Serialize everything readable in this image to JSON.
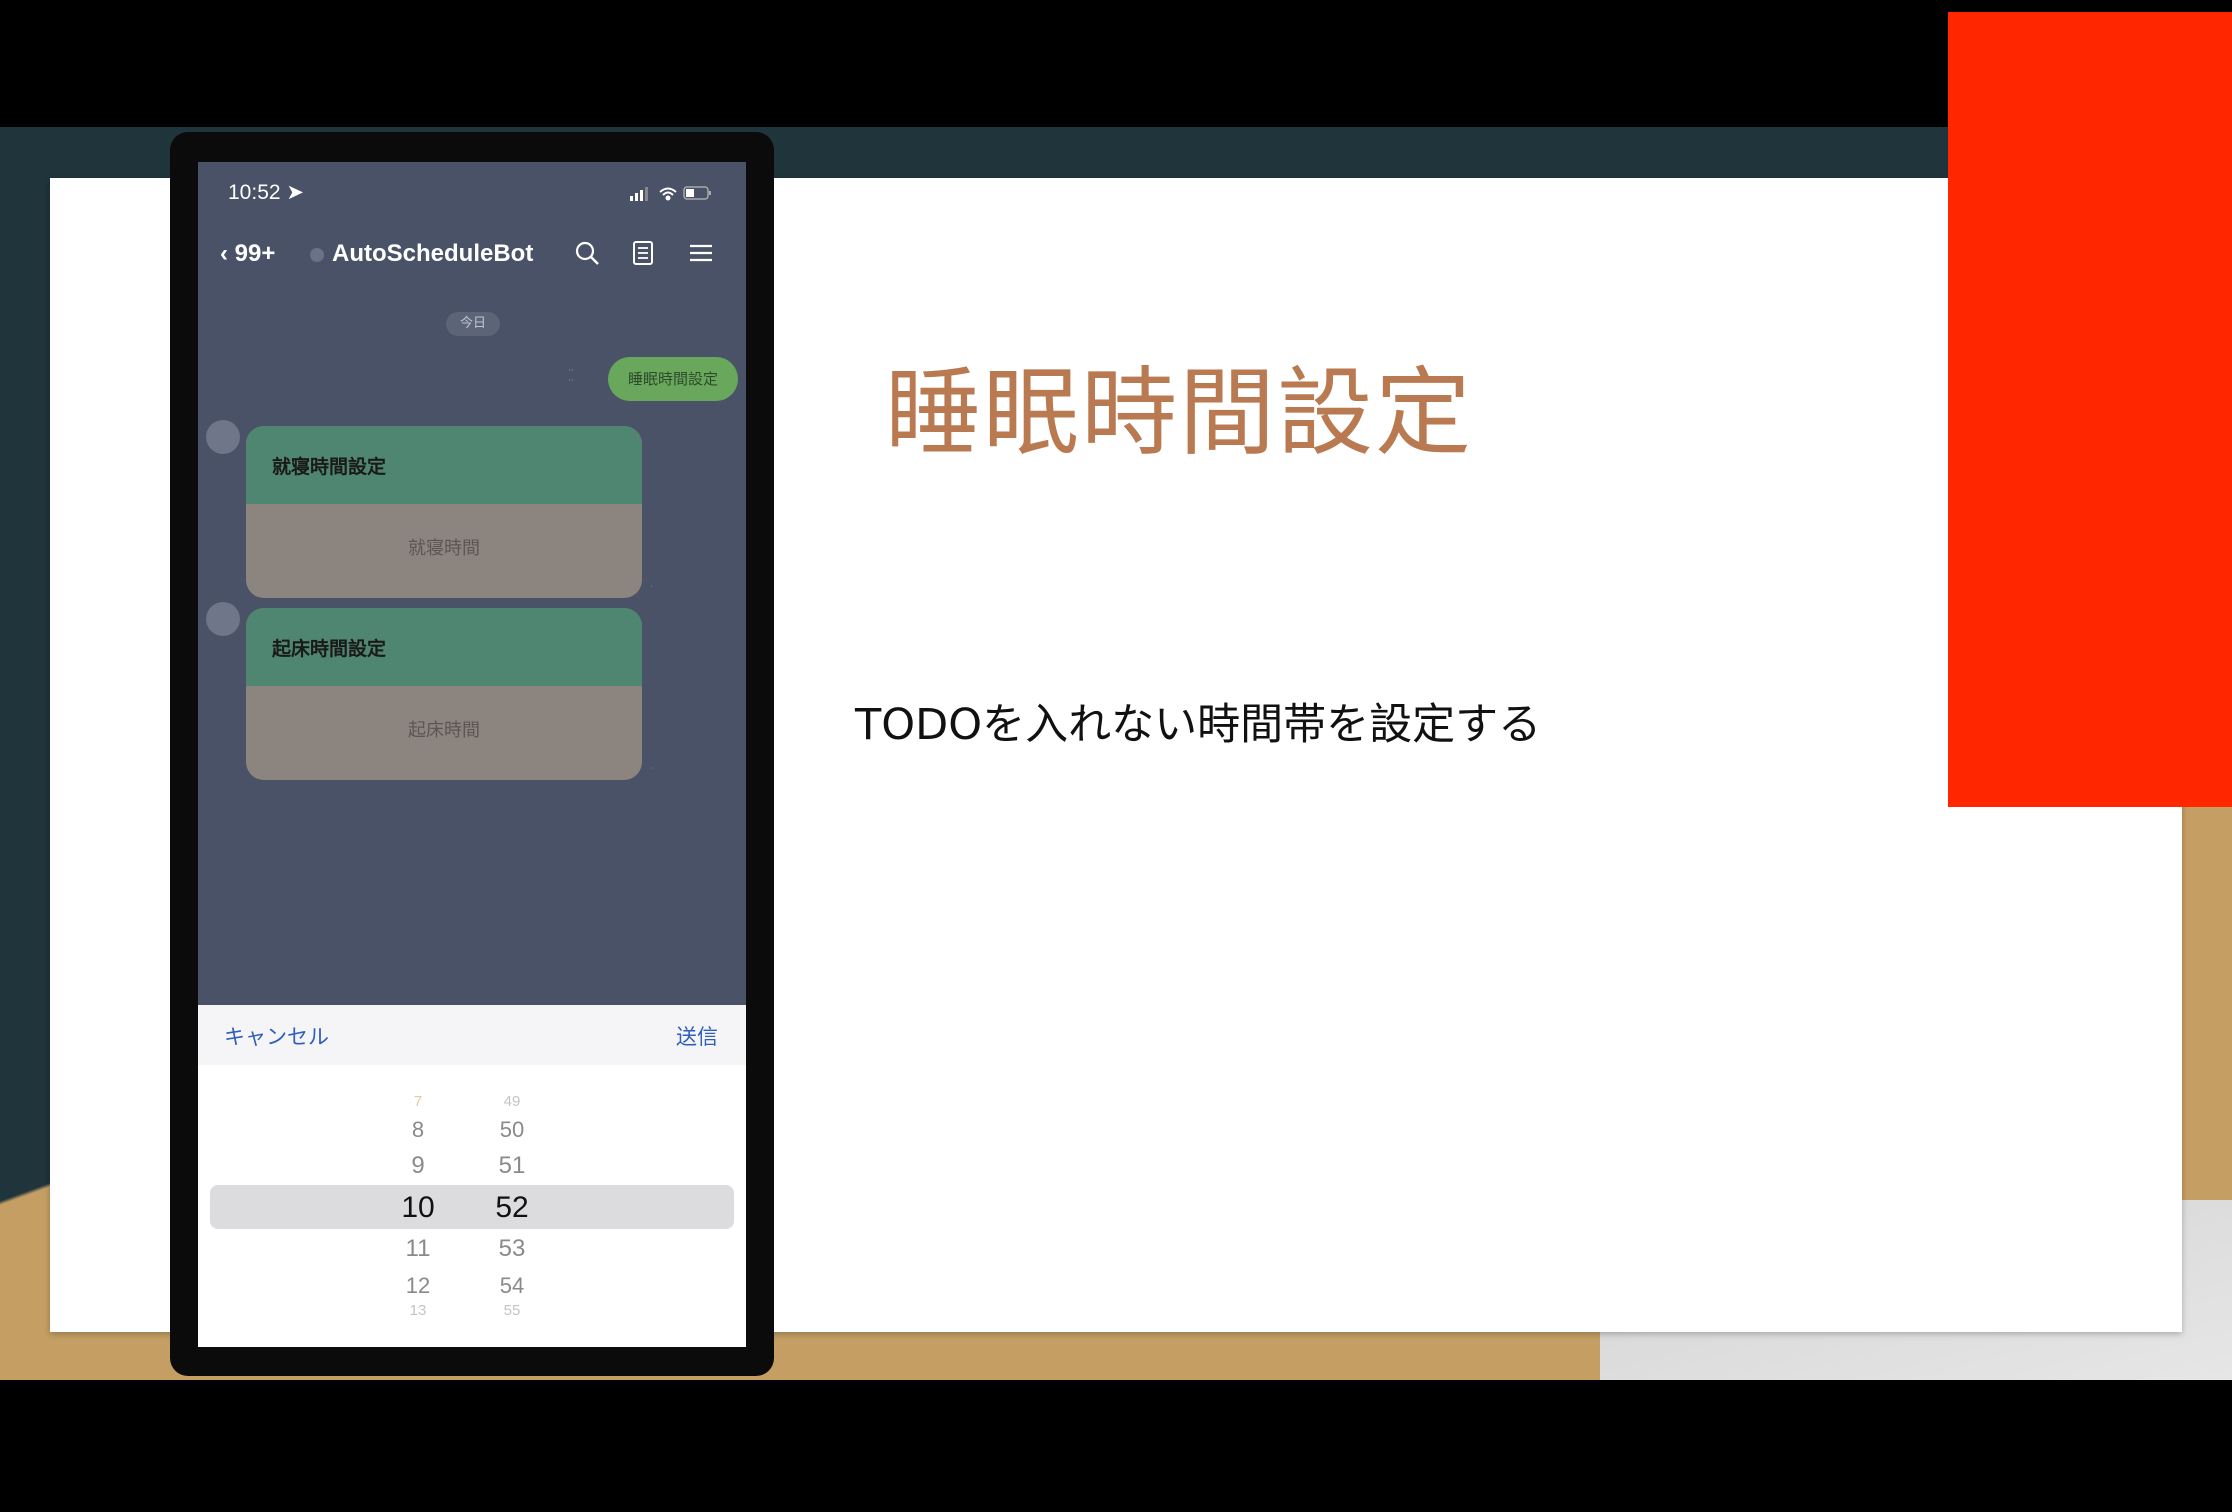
{
  "slide": {
    "title": "睡眠時間設定",
    "body": "TODOを入れない時間帯を設定する"
  },
  "colors": {
    "title": "#b97a52",
    "red_box": "#ff2600",
    "card_header": "#4f8671",
    "sent_bubble": "#69a85c",
    "link_blue": "#2f5fb8"
  },
  "phone": {
    "status": {
      "time": "10:52 ➤",
      "icons": [
        "signal-icon",
        "wifi-icon",
        "battery-icon"
      ]
    },
    "nav": {
      "back": "99+",
      "title": "AutoScheduleBot",
      "icons": [
        "search-icon",
        "notes-icon",
        "menu-icon"
      ]
    },
    "date_pill": "今日",
    "sent_message": "睡眠時間設定",
    "cards": [
      {
        "header": "就寝時間設定",
        "action": "就寝時間"
      },
      {
        "header": "起床時間設定",
        "action": "起床時間"
      }
    ],
    "picker": {
      "cancel": "キャンセル",
      "send": "送信",
      "hours": [
        "7",
        "8",
        "9",
        "10",
        "11",
        "12",
        "13"
      ],
      "minutes": [
        "49",
        "50",
        "51",
        "52",
        "53",
        "54",
        "55"
      ],
      "selected_hour": "10",
      "selected_minute": "52"
    }
  }
}
